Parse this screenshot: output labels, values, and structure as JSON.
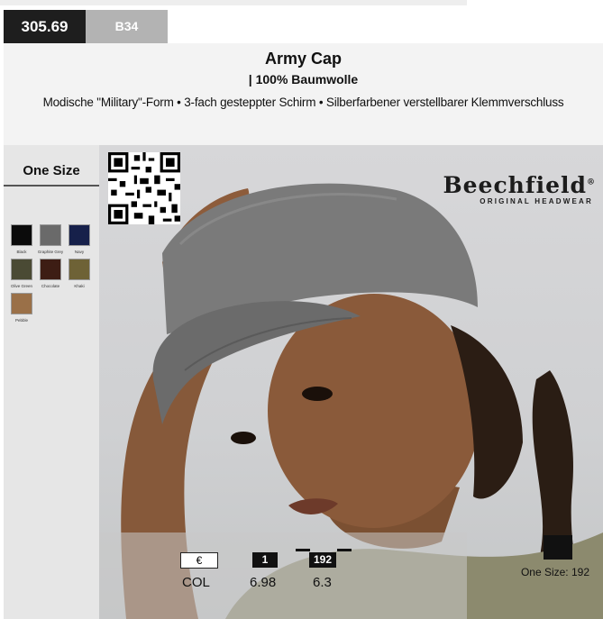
{
  "product": {
    "price": "305.69",
    "article_code": "B34",
    "title": "Army Cap",
    "subtitle": "| 100% Baumwolle",
    "description": "Modische \"Military\"-Form • 3-fach gesteppter Schirm • Silberfarbener verstellbarer Klemmverschluss"
  },
  "sidebar": {
    "size_heading": "One Size",
    "swatches": [
      {
        "name": "Black",
        "color": "#0b0b0b"
      },
      {
        "name": "Graphite Grey",
        "color": "#6a6a6a"
      },
      {
        "name": "Navy",
        "color": "#16204a"
      },
      {
        "name": "Olive Green",
        "color": "#4a4a34"
      },
      {
        "name": "Chocolate",
        "color": "#3d1d14"
      },
      {
        "name": "Khaki",
        "color": "#6e6236"
      },
      {
        "name": "Pebble",
        "color": "#9a7048"
      }
    ]
  },
  "brand": {
    "name": "Beechfield",
    "registered": "®",
    "tagline": "ORIGINAL HEADWEAR"
  },
  "pricing": {
    "currency_symbol": "€",
    "col_label": "COL",
    "tier1_qty": "1",
    "tier1_price": "6.98",
    "tier2_qty": "192",
    "tier2_price": "6.3",
    "size_note": "One Size: 192"
  }
}
